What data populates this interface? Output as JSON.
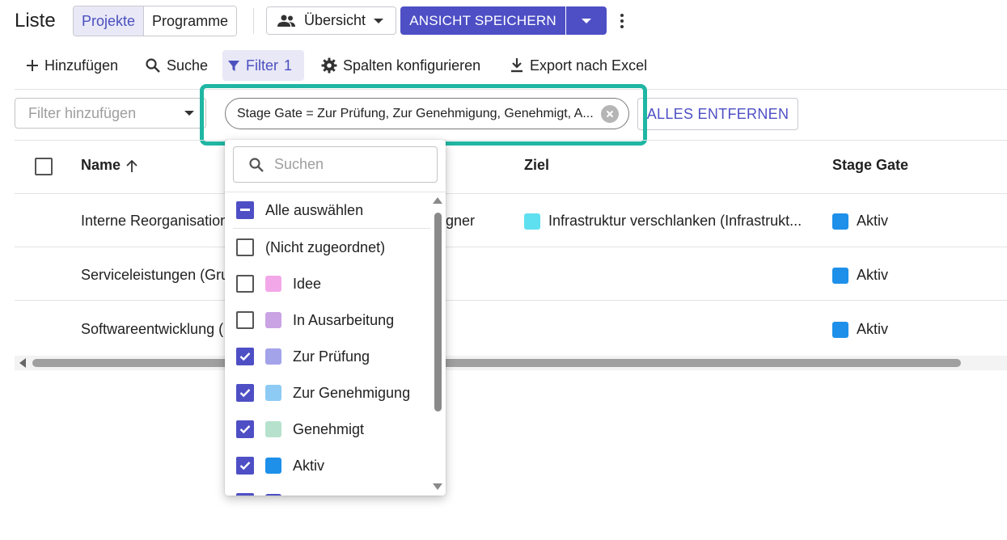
{
  "header": {
    "title": "Liste",
    "segments": [
      "Projekte",
      "Programme"
    ],
    "view_label": "Übersicht",
    "save_label": "ANSICHT SPEICHERN"
  },
  "toolbar": {
    "add": "Hinzufügen",
    "search": "Suche",
    "filter": "Filter",
    "filter_count": "1",
    "columns": "Spalten konfigurieren",
    "export": "Export nach Excel"
  },
  "filter_bar": {
    "add_placeholder": "Filter hinzufügen",
    "chip_text": "Stage Gate = Zur Prüfung, Zur Genehmigung, Genehmigt, A...",
    "remove_all": "ALLES ENTFERNEN"
  },
  "table": {
    "columns": [
      "Name",
      "Ziel",
      "Stage Gate"
    ],
    "rows": [
      {
        "name": "Interne Reorganisation",
        "owner_fragment": "gner",
        "ziel": "Infrastruktur verschlanken (Infrastrukt...",
        "ziel_color": "#5ee0f0",
        "stage": "Aktiv",
        "stage_color": "#1e90ea"
      },
      {
        "name": "Serviceleistungen (Gru",
        "owner_fragment": "",
        "ziel": "",
        "ziel_color": "",
        "stage": "Aktiv",
        "stage_color": "#1e90ea"
      },
      {
        "name": "Softwareentwicklung (",
        "owner_fragment": "",
        "ziel": "",
        "ziel_color": "",
        "stage": "Aktiv",
        "stage_color": "#1e90ea"
      }
    ]
  },
  "dropdown": {
    "search_placeholder": "Suchen",
    "select_all": "Alle auswählen",
    "options": [
      {
        "label": "(Nicht zugeordnet)",
        "checked": false,
        "color": ""
      },
      {
        "label": "Idee",
        "checked": false,
        "color": "#f2a8e8"
      },
      {
        "label": "In Ausarbeitung",
        "checked": false,
        "color": "#c9a3e3"
      },
      {
        "label": "Zur Prüfung",
        "checked": true,
        "color": "#a3a3ea"
      },
      {
        "label": "Zur Genehmigung",
        "checked": true,
        "color": "#8ecbf4"
      },
      {
        "label": "Genehmigt",
        "checked": true,
        "color": "#b6e2cd"
      },
      {
        "label": "Aktiv",
        "checked": true,
        "color": "#1e90ea"
      }
    ]
  },
  "colors": {
    "accent": "#4e4fc5",
    "highlight": "#1fb6a3"
  }
}
